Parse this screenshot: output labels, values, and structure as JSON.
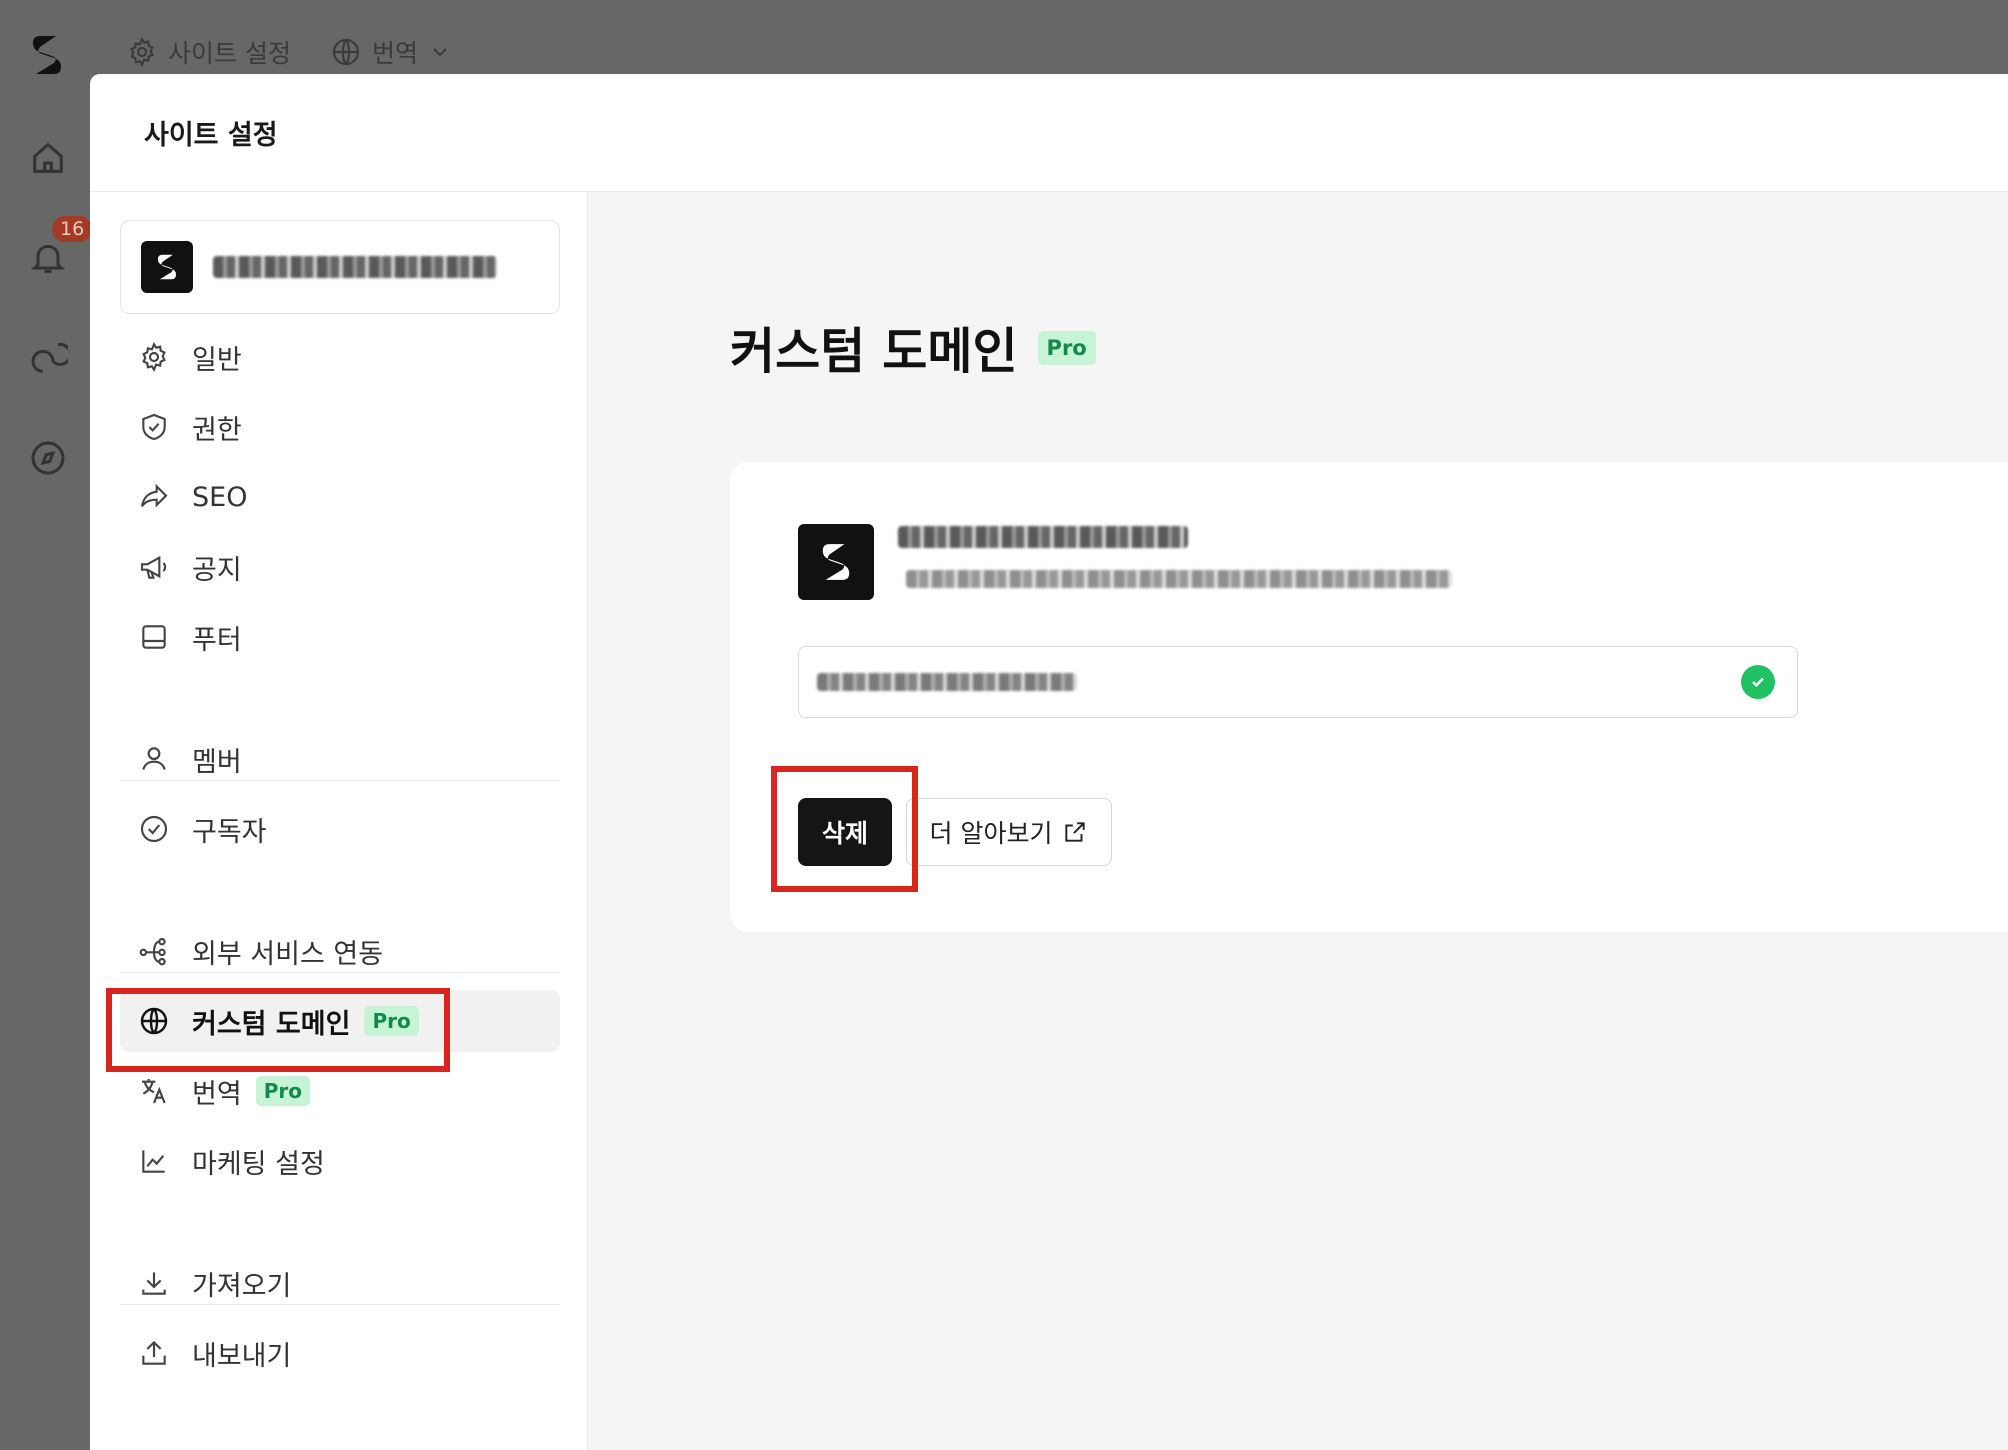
{
  "topbar": {
    "site_settings_label": "사이트 설정",
    "translate_label": "번역"
  },
  "rail": {
    "notification_count": "16"
  },
  "modal": {
    "title": "사이트 설정"
  },
  "sidebar": {
    "groups": [
      [
        {
          "label": "일반",
          "icon": "gear-icon"
        },
        {
          "label": "권한",
          "icon": "shield-icon"
        },
        {
          "label": "SEO",
          "icon": "share-arrow-icon"
        },
        {
          "label": "공지",
          "icon": "megaphone-icon"
        },
        {
          "label": "푸터",
          "icon": "footer-layout-icon"
        }
      ],
      [
        {
          "label": "멤버",
          "icon": "user-icon"
        },
        {
          "label": "구독자",
          "icon": "check-circle-icon"
        }
      ],
      [
        {
          "label": "외부 서비스 연동",
          "icon": "integration-icon"
        },
        {
          "label": "커스텀 도메인",
          "icon": "globe-icon",
          "pro": "Pro",
          "active": true
        },
        {
          "label": "번역",
          "icon": "translate-icon",
          "pro": "Pro"
        },
        {
          "label": "마케팅 설정",
          "icon": "chart-line-icon"
        }
      ],
      [
        {
          "label": "가져오기",
          "icon": "download-icon"
        },
        {
          "label": "내보내기",
          "icon": "upload-icon"
        }
      ]
    ]
  },
  "main": {
    "title": "커스텀 도메인",
    "pro_badge": "Pro",
    "delete_button": "삭제",
    "learn_more_button": "더 알아보기"
  },
  "colors": {
    "pro_bg": "#c7f3d7",
    "pro_text": "#118a4a",
    "highlight": "#d9261c",
    "success": "#1fc163"
  }
}
